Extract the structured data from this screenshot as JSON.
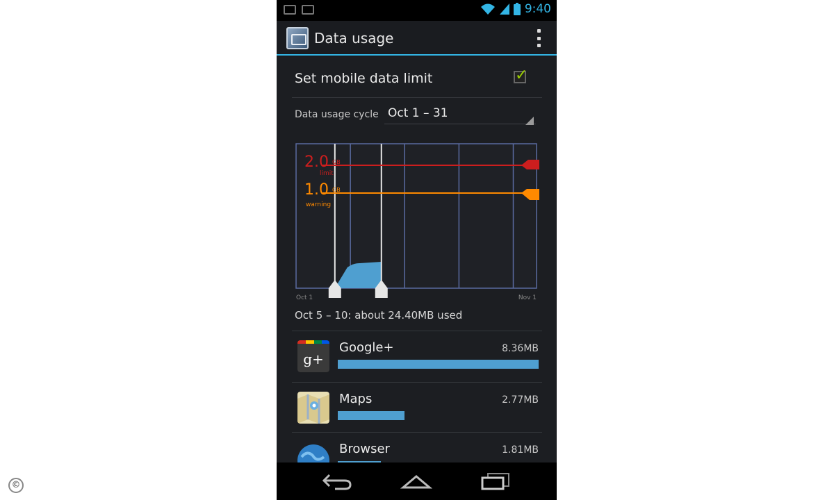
{
  "status_bar": {
    "time": "9:40",
    "left_icons": [
      "image-notification-icon",
      "message-notification-icon"
    ],
    "right_icons": [
      "wifi-icon",
      "signal-icon",
      "battery-icon"
    ]
  },
  "action_bar": {
    "title": "Data usage",
    "app_icon": "settings-app-icon",
    "overflow_icon": "overflow-menu-icon"
  },
  "limit_row": {
    "label": "Set mobile data limit",
    "checked": true
  },
  "cycle_row": {
    "label": "Data usage cycle",
    "value": "Oct 1 – 31"
  },
  "chart_data": {
    "type": "area",
    "x_start_label": "Oct 1",
    "x_end_label": "Nov 1",
    "limit": {
      "value": "2.0",
      "unit": "GB",
      "label": "limit",
      "color": "#cc1e1e"
    },
    "warning": {
      "value": "1.0",
      "unit": "GB",
      "label": "warning",
      "color": "#ff8a00"
    },
    "selection_start_day": 5,
    "selection_end_day": 10,
    "area_color": "#4f9fd0",
    "grid_lines": true
  },
  "summary": "Oct 5 – 10: about 24.40MB used",
  "apps": [
    {
      "name": "Google+",
      "size": "8.36MB",
      "icon": "google-plus-icon",
      "usage_fraction": 1.0
    },
    {
      "name": "Maps",
      "size": "2.77MB",
      "icon": "maps-icon",
      "usage_fraction": 0.331
    },
    {
      "name": "Browser",
      "size": "1.81MB",
      "icon": "browser-icon",
      "usage_fraction": 0.216
    }
  ],
  "nav_bar": {
    "buttons": [
      "back-icon",
      "home-icon",
      "recent-apps-icon"
    ]
  },
  "watermark": "©",
  "colors": {
    "accent": "#33b5e5",
    "check": "#99cc00",
    "bar": "#4f9fd0"
  }
}
